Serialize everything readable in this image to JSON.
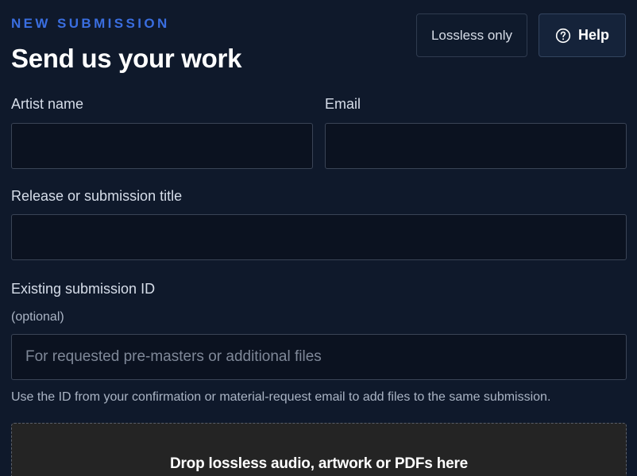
{
  "header": {
    "eyebrow": "NEW SUBMISSION",
    "title": "Send us your work",
    "lossless_label": "Lossless only",
    "help_label": "Help"
  },
  "form": {
    "artist_name": {
      "label": "Artist name",
      "value": "",
      "placeholder": ""
    },
    "email": {
      "label": "Email",
      "value": "",
      "placeholder": ""
    },
    "release_title": {
      "label": "Release or submission title",
      "value": "",
      "placeholder": ""
    },
    "submission_id": {
      "label": "Existing submission ID",
      "sublabel": "(optional)",
      "value": "",
      "placeholder": "For requested pre-masters or additional files",
      "help": "Use the ID from your confirmation or material-request email to add files to the same submission."
    }
  },
  "dropzone": {
    "text": "Drop lossless audio, artwork or PDFs here"
  },
  "icons": {
    "help": "question-circle-icon"
  },
  "colors": {
    "background": "#0f192b",
    "accent": "#3a6ee0",
    "input_bg": "#0b1220",
    "dropzone_bg": "#242424"
  }
}
